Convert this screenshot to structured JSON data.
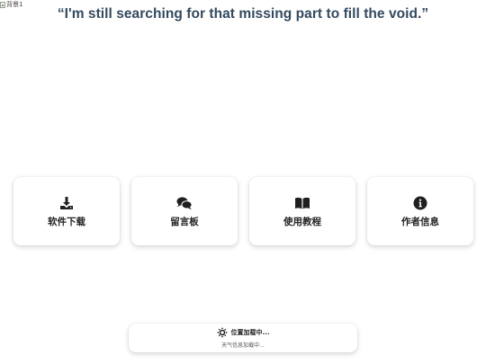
{
  "background_image": {
    "alt_text": "背景1",
    "icon": "broken-image-icon"
  },
  "quote": {
    "text": "“I'm still searching for that missing part to fill the void.”"
  },
  "cards": [
    {
      "label": "软件下载",
      "icon": "download-icon"
    },
    {
      "label": "留言板",
      "icon": "comments-icon"
    },
    {
      "label": "使用教程",
      "icon": "book-icon"
    },
    {
      "label": "作者信息",
      "icon": "info-circle-icon"
    }
  ],
  "weather": {
    "location": "位置加载中...",
    "status": "天气信息加载中...",
    "icon": "sun-icon"
  },
  "colors": {
    "quote_text": "#34495e",
    "card_text": "#222222",
    "icon": "#1f1f1f",
    "background": "#ffffff"
  }
}
